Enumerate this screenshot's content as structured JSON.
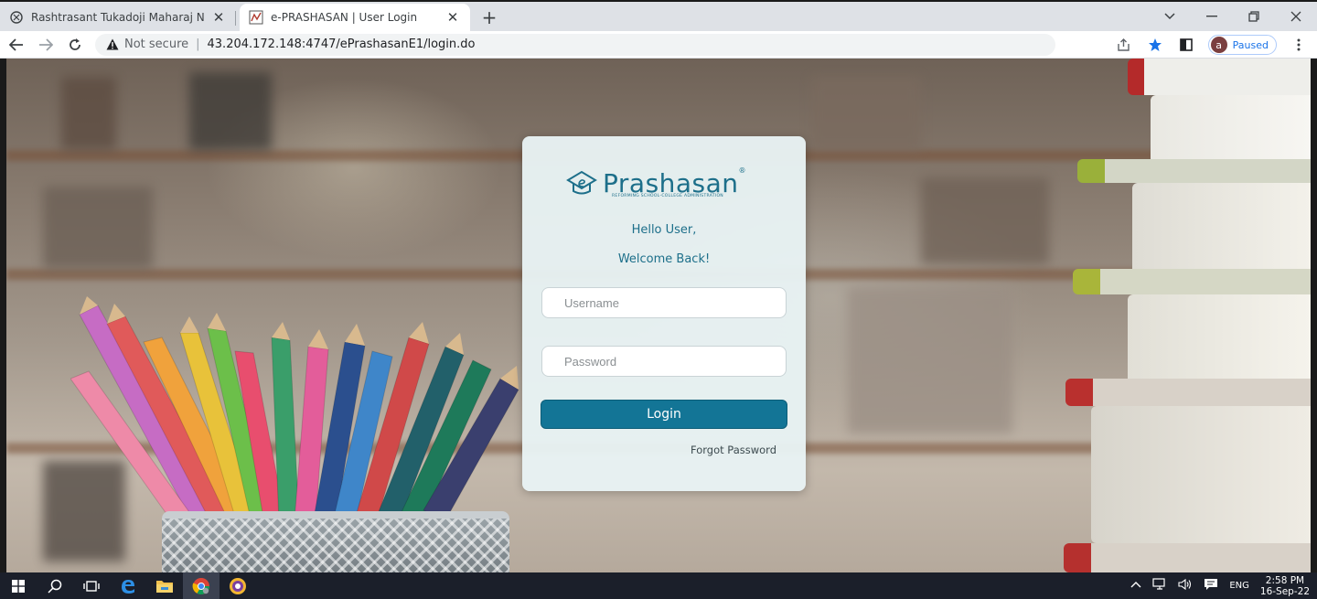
{
  "browser": {
    "tabs": [
      {
        "title": "Rashtrasant Tukadoji Maharaj Na",
        "active": false,
        "favicon": "globe-icon"
      },
      {
        "title": "e-PRASHASAN | User Login",
        "active": true,
        "favicon": "site-logo-icon"
      }
    ],
    "address": {
      "security_label": "Not secure",
      "separator": "|",
      "url": "43.204.172.148:4747/ePrashasanE1/login.do"
    },
    "profile": {
      "initial": "a",
      "status": "Paused"
    }
  },
  "login": {
    "brand": "Prashasan",
    "brand_mark": "®",
    "tagline": "REFORMING SCHOOL-COLLEGE ADMINISTRATION",
    "greeting_line1": "Hello User,",
    "greeting_line2": "Welcome Back!",
    "username_placeholder": "Username",
    "password_placeholder": "Password",
    "login_label": "Login",
    "forgot_label": "Forgot Password"
  },
  "taskbar": {
    "language": "ENG",
    "time": "2:58 PM",
    "date": "16-Sep-22"
  },
  "colors": {
    "brand": "#1d6f8a",
    "button": "#137596",
    "card": "#e8f2f4",
    "taskbar": "#1b1f2a"
  }
}
